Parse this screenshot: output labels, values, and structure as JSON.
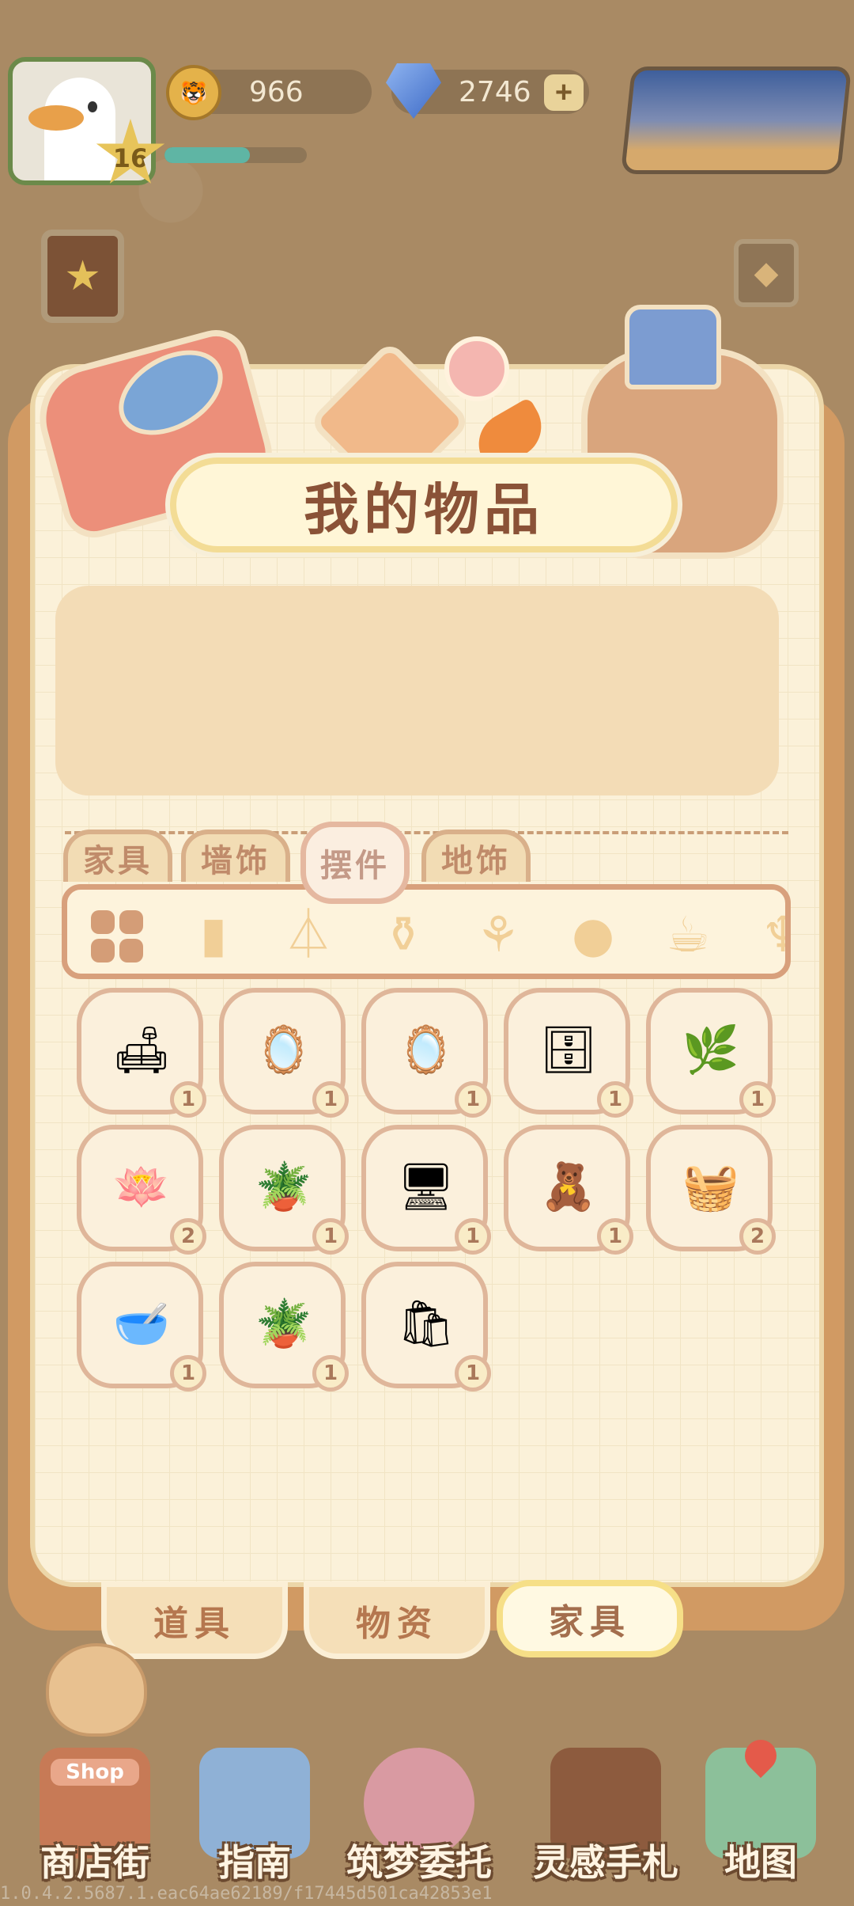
{
  "player": {
    "level": "16",
    "xp_fraction": 0.6
  },
  "currency": {
    "coins": "966",
    "gems": "2746",
    "add_label": "+"
  },
  "panel": {
    "title": "我的物品"
  },
  "category_tabs": [
    {
      "label": "家具"
    },
    {
      "label": "墙饰"
    },
    {
      "label": "摆件"
    },
    {
      "label": "地饰"
    }
  ],
  "active_category_tab": "摆件",
  "items": [
    {
      "name": "pillow-cushion",
      "count": "1",
      "emoji": "🛋"
    },
    {
      "name": "red-mirror",
      "count": "1",
      "emoji": "🪞"
    },
    {
      "name": "floor-mirror",
      "count": "1",
      "emoji": "🪞"
    },
    {
      "name": "display-cabinet",
      "count": "1",
      "emoji": "🗄"
    },
    {
      "name": "plant-box",
      "count": "1",
      "emoji": "🌿"
    },
    {
      "name": "lotus-basin",
      "count": "2",
      "emoji": "🪷"
    },
    {
      "name": "bonsai-tree",
      "count": "1",
      "emoji": "🪴"
    },
    {
      "name": "computer-desk",
      "count": "1",
      "emoji": "🖥"
    },
    {
      "name": "toy-set",
      "count": "1",
      "emoji": "🧸"
    },
    {
      "name": "fruit-basket",
      "count": "2",
      "emoji": "🧺"
    },
    {
      "name": "pet-bowl",
      "count": "1",
      "emoji": "🥣"
    },
    {
      "name": "plant-tray",
      "count": "1",
      "emoji": "🪴"
    },
    {
      "name": "gift-bag",
      "count": "1",
      "emoji": "🛍"
    }
  ],
  "bottom_tabs": [
    {
      "label": "道具"
    },
    {
      "label": "物资"
    },
    {
      "label": "家具"
    }
  ],
  "active_bottom_tab": "家具",
  "nav": [
    {
      "label": "商店街",
      "sign": "Shop"
    },
    {
      "label": "指南"
    },
    {
      "label": "筑梦委托"
    },
    {
      "label": "灵感手札"
    },
    {
      "label": "地图"
    }
  ],
  "version": "1.0.4.2.5687.1.eac64ae62189/f17445d501ca42853e1"
}
